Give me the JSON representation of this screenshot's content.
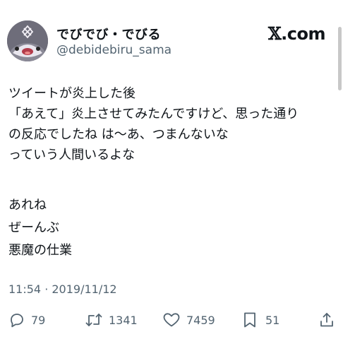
{
  "header": {
    "display_name": "でびでび・でびる",
    "handle": "@debidebiru_sama",
    "brand_x": "𝕏",
    "brand_suffix": ".com"
  },
  "tweet": {
    "lines": [
      "ツイートが炎上した後",
      "「あえて」炎上させてみたんですけど、思った通り",
      "の反応でしたね は〜あ、つまんないな",
      "っていう人間いるよな",
      "",
      "あれね",
      "ぜーんぶ",
      "悪魔の仕業"
    ],
    "timestamp": "11:54 · 2019/11/12"
  },
  "actions": {
    "reply": {
      "icon": "reply-icon",
      "count": "79"
    },
    "retweet": {
      "icon": "retweet-icon",
      "count": "1341"
    },
    "like": {
      "icon": "heart-icon",
      "count": "7459"
    },
    "bookmark": {
      "icon": "bookmark-icon",
      "count": "51"
    },
    "share": {
      "icon": "share-icon"
    }
  },
  "colors": {
    "text": "#0f1419",
    "secondary": "#536471"
  }
}
